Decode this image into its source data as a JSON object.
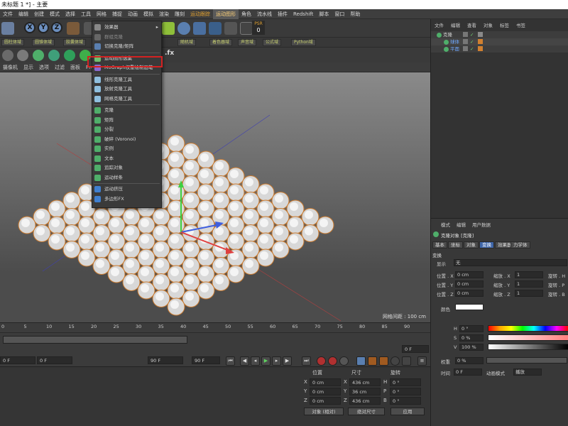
{
  "window": {
    "title": "未标题 1 *] - 主要"
  },
  "menubar": [
    {
      "label": "文件",
      "hl": false
    },
    {
      "label": "编辑",
      "hl": false
    },
    {
      "label": "创建",
      "hl": false
    },
    {
      "label": "模式",
      "hl": false
    },
    {
      "label": "选择",
      "hl": false
    },
    {
      "label": "工具",
      "hl": false
    },
    {
      "label": "网格",
      "hl": false
    },
    {
      "label": "捕捉",
      "hl": false
    },
    {
      "label": "动画",
      "hl": false
    },
    {
      "label": "模拟",
      "hl": false
    },
    {
      "label": "渲染",
      "hl": false
    },
    {
      "label": "雕刻",
      "hl": false
    },
    {
      "label": "运动跟踪",
      "hl": true
    },
    {
      "label": "运动图形",
      "hl": true,
      "open": true
    },
    {
      "label": "角色",
      "hl": false
    },
    {
      "label": "流水线",
      "hl": false
    },
    {
      "label": "插件",
      "hl": false
    },
    {
      "label": "Redshift",
      "hl": false
    },
    {
      "label": "脚本",
      "hl": false
    },
    {
      "label": "窗口",
      "hl": false
    },
    {
      "label": "帮助",
      "hl": false
    }
  ],
  "toolbar1": {
    "psr_label": "PSR",
    "psr_value": "0"
  },
  "toolbar2": [
    {
      "label": "圆柱体域"
    },
    {
      "label": "圆锥体域"
    },
    {
      "label": "胶囊体域"
    },
    {
      "label": "随机域"
    },
    {
      "label": "着色器域"
    },
    {
      "label": "声音域"
    },
    {
      "label": "公式域"
    },
    {
      "label": "Python域"
    }
  ],
  "viewport": {
    "menus": [
      "摄像机",
      "显示",
      "选项",
      "过滤",
      "面板",
      "ProRender"
    ],
    "label": "网格间距 : 100 cm",
    "fx_label": ".fx"
  },
  "dropdown": {
    "items": [
      {
        "label": "效果器",
        "disabled": false,
        "arrow": true,
        "icon": "effector-icon"
      },
      {
        "label": "群组克隆",
        "disabled": true,
        "icon": "group-clone-icon"
      },
      {
        "label": "切换克隆/矩阵",
        "disabled": false,
        "icon": "toggle-icon"
      },
      {
        "label": "运动图形选集",
        "disabled": false,
        "icon": "selection-icon"
      },
      {
        "label": "MoGraph权重绘制画笔",
        "disabled": false,
        "icon": "brush-icon"
      },
      {
        "label": "线形克隆工具",
        "disabled": false,
        "icon": "linear-clone-icon"
      },
      {
        "label": "放射克隆工具",
        "disabled": false,
        "icon": "radial-clone-icon"
      },
      {
        "label": "网格克隆工具",
        "disabled": false,
        "icon": "grid-clone-icon"
      },
      {
        "label": "克隆",
        "disabled": false,
        "icon": "cloner-icon"
      },
      {
        "label": "矩阵",
        "disabled": false,
        "icon": "matrix-icon"
      },
      {
        "label": "分裂",
        "disabled": false,
        "icon": "fracture-icon"
      },
      {
        "label": "破碎 (Voronoi)",
        "disabled": false,
        "icon": "voronoi-icon"
      },
      {
        "label": "实例",
        "disabled": false,
        "icon": "instance-icon"
      },
      {
        "label": "文本",
        "disabled": false,
        "icon": "text-icon"
      },
      {
        "label": "追踪对象",
        "disabled": false,
        "icon": "tracer-icon"
      },
      {
        "label": "运动样条",
        "disabled": false,
        "icon": "motion-spline-icon"
      },
      {
        "label": "运动挤压",
        "disabled": false,
        "icon": "extrude-icon"
      },
      {
        "label": "多边形FX",
        "disabled": false,
        "icon": "polyfx-icon"
      }
    ]
  },
  "timeline": {
    "ticks": [
      "0",
      "5",
      "10",
      "15",
      "20",
      "25",
      "30",
      "35",
      "40",
      "45",
      "50",
      "55",
      "60",
      "65",
      "70",
      "75",
      "80",
      "85",
      "90"
    ],
    "end_frame": "0 F",
    "start": "0 F",
    "current": "0 F",
    "max1": "90 F",
    "max2": "90 F"
  },
  "coords": {
    "headers": [
      "位置",
      "尺寸",
      "旋转"
    ],
    "rows": [
      {
        "axis": "X",
        "pos": "0 cm",
        "size_axis": "X",
        "size": "436 cm",
        "rot_axis": "H",
        "rot": "0 °"
      },
      {
        "axis": "Y",
        "pos": "0 cm",
        "size_axis": "Y",
        "size": "36 cm",
        "rot_axis": "P",
        "rot": "0 °"
      },
      {
        "axis": "Z",
        "pos": "0 cm",
        "size_axis": "Z",
        "size": "436 cm",
        "rot_axis": "B",
        "rot": "0 °"
      }
    ],
    "mode1": "对象 (相对)",
    "mode2": "绝对尺寸",
    "apply": "应用"
  },
  "objects": {
    "tabs": [
      "文件",
      "编辑",
      "查看",
      "对象",
      "标签",
      "书签"
    ],
    "rows": [
      {
        "name": "克隆",
        "indent": 0
      },
      {
        "name": "球体",
        "indent": 1
      },
      {
        "name": "平面",
        "indent": 1
      }
    ]
  },
  "attributes": {
    "menu": [
      "模式",
      "编辑",
      "用户数据"
    ],
    "title": "克隆对象 [克隆]",
    "tabs": [
      "基本",
      "坐标",
      "对象",
      "变换",
      "效果器",
      "力学体"
    ],
    "active_tab": "变换",
    "section": "变换",
    "display_label": "显示",
    "display_value": "无",
    "pos": [
      {
        "a": "位置 . X",
        "v": "0 cm"
      },
      {
        "a": "位置 . Y",
        "v": "0 cm"
      },
      {
        "a": "位置 . Z",
        "v": "0 cm"
      }
    ],
    "scale": [
      {
        "a": "缩放 . X",
        "v": "1"
      },
      {
        "a": "缩放 . Y",
        "v": "1"
      },
      {
        "a": "缩放 . Z",
        "v": "1"
      }
    ],
    "rot": [
      {
        "a": "旋转 . H"
      },
      {
        "a": "旋转 . P"
      },
      {
        "a": "旋转 . B"
      }
    ],
    "color_label": "颜色",
    "hsv": [
      {
        "a": "H",
        "v": "0 °"
      },
      {
        "a": "S",
        "v": "0 %"
      },
      {
        "a": "V",
        "v": "100 %"
      }
    ],
    "weight_label": "权重",
    "weight_value": "0 %",
    "time_label": "时间",
    "time_value": "0 F",
    "anim_label": "动画模式",
    "anim_value": "播放"
  }
}
